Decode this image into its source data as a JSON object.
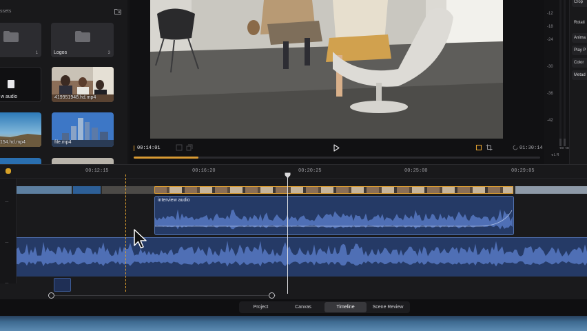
{
  "library": {
    "title": "ssets",
    "folders": [
      {
        "name": "",
        "count": "1"
      },
      {
        "name": "Logos",
        "count": "3"
      }
    ],
    "items": [
      {
        "name": "w audio",
        "kind": "audio"
      },
      {
        "name": "419951948.hd.mp4",
        "kind": "video"
      },
      {
        "name": "154.hd.mp4",
        "kind": "video"
      },
      {
        "name": "file.mp4",
        "kind": "video"
      }
    ]
  },
  "viewer": {
    "current_time": "00:14:01",
    "duration": "01:30:14",
    "scrub_progress": 0.16
  },
  "meters": {
    "scale": [
      "-12",
      "-18",
      "-24",
      "-30",
      "-36",
      "-42"
    ],
    "footer": "-oo -oo",
    "channels": "◂ L R",
    "level_left": 0.05,
    "level_right": 0.05
  },
  "inspector": {
    "items": [
      "Crop",
      "Rotati",
      "Anima",
      "Play P",
      "Color",
      "Metad"
    ]
  },
  "timeline": {
    "ruler": [
      "00:12:15",
      "00:16:20",
      "00:20:25",
      "00:25:00",
      "00:29:05"
    ],
    "track_menu": "···",
    "audio_clip_label": "interview audio"
  },
  "bottom_tabs": {
    "items": [
      "Project",
      "Canvas",
      "Timeline",
      "Scene Review"
    ],
    "active": "Timeline"
  },
  "colors": {
    "accent": "#e0a032",
    "audio_clip": "#253a66",
    "waveform": "#4f6fb5"
  }
}
